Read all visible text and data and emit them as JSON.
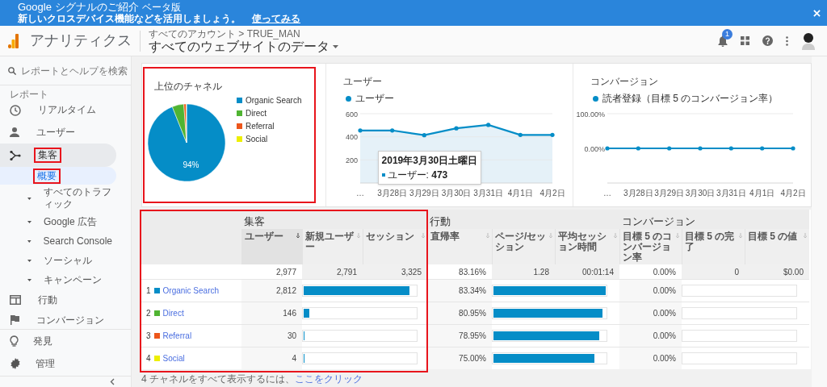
{
  "banner": {
    "title": "Google シグナルのご紹介",
    "badge": "ベータ版",
    "message": "新しいクロスデバイス機能などを活用しましょう。",
    "link": "使ってみる"
  },
  "header": {
    "product": "アナリティクス",
    "breadcrumb": "すべてのアカウント > TRUE_MAN",
    "view": "すべてのウェブサイトのデータ",
    "notification_count": "1"
  },
  "sidebar": {
    "search": {
      "placeholder": "レポートとヘルプを検索"
    },
    "section_label": "レポート",
    "items": [
      {
        "label": "リアルタイム",
        "highlighted": false
      },
      {
        "label": "ユーザー",
        "highlighted": false
      },
      {
        "label": "集客",
        "highlighted": true,
        "expanded": true,
        "children": [
          {
            "label": "概要",
            "selected": true,
            "highlighted": true
          },
          {
            "label": "すべてのトラフィック",
            "selected": false,
            "highlighted": false,
            "expanded": false
          },
          {
            "label": "Google 広告",
            "selected": false,
            "highlighted": false,
            "expanded": false
          },
          {
            "label": "Search Console",
            "selected": false,
            "highlighted": false,
            "expanded": false
          },
          {
            "label": "ソーシャル",
            "selected": false,
            "highlighted": false,
            "expanded": false
          },
          {
            "label": "キャンペーン",
            "selected": false,
            "highlighted": false,
            "expanded": false
          }
        ]
      },
      {
        "label": "行動",
        "highlighted": false,
        "expanded": false
      },
      {
        "label": "コンバージョン",
        "highlighted": false,
        "expanded": false
      }
    ],
    "bottom_items": [
      {
        "label": "発見"
      },
      {
        "label": "管理"
      }
    ]
  },
  "cards": [
    {
      "title": "上位のチャネル",
      "highlighted": true,
      "chart_data": {
        "type": "pie",
        "categories": [
          "Organic Search",
          "Direct",
          "Referral",
          "Social"
        ],
        "series": [
          {
            "values": [
              93.99,
              4.88,
              1.0,
              0.13
            ]
          }
        ],
        "colors": [
          "#058dc7",
          "#50b432",
          "#ed561b",
          "#edef00"
        ],
        "value_labels": [
          "94%",
          null,
          null,
          null
        ]
      }
    },
    {
      "title": "ユーザー",
      "highlighted": false,
      "chart_data": {
        "type": "area",
        "categories": [
          "…",
          "3月28日",
          "3月29日",
          "3月30日",
          "3月31日",
          "4月1日",
          "4月2日"
        ],
        "series": [
          {
            "name": "ユーザー",
            "color": "#058dc7",
            "values": [
              455,
              455,
              414,
              473,
              503,
              416,
              416
            ]
          }
        ],
        "ylim": [
          0,
          600
        ],
        "yticks": [
          200,
          400,
          600
        ]
      },
      "tooltip": {
        "title": "2019年3月30日土曜日",
        "text": "ユーザー: **473**"
      }
    },
    {
      "title": "コンバージョン",
      "highlighted": false,
      "chart_data": {
        "type": "line",
        "categories": [
          "…",
          "3月28日",
          "3月29日",
          "3月30日",
          "3月31日",
          "4月1日",
          "4月2日"
        ],
        "series": [
          {
            "name": "読者登録（目標 5 のコンバージョン率）",
            "color": "#058dc7",
            "values": [
              0,
              0,
              0,
              0,
              0,
              0,
              0
            ]
          }
        ],
        "ylim": [
          -100,
          100
        ],
        "yticks": [
          {
            "value": 0,
            "label": "0.00%"
          },
          {
            "value": 100,
            "label": "100.00%"
          }
        ]
      }
    }
  ],
  "table": {
    "highlighted": true,
    "groups": [
      "集客",
      "行動",
      "コンバージョン"
    ],
    "columns": [
      {
        "label": "ユーザー",
        "sorted": true
      },
      {
        "label": "新規ユーザー",
        "sorted": false
      },
      {
        "label": "セッション",
        "sorted": false
      },
      {
        "label": "直帰率",
        "sorted": false
      },
      {
        "label": "ページ/セッション",
        "sorted": false
      },
      {
        "label": "平均セッション時間",
        "sorted": false
      },
      {
        "label": "目標 5 のコンバージョン率",
        "sorted": false
      },
      {
        "label": "目標 5 の完了",
        "sorted": false
      },
      {
        "label": "目標 5 の値",
        "sorted": false
      }
    ],
    "totals": [
      "2,977",
      "2,791",
      "3,325",
      "83.16%",
      "1.28",
      "00:01:14",
      "0.00%",
      "0",
      "$0.00"
    ],
    "rows": [
      {
        "rank": "1",
        "channel": "Organic Search",
        "color": "#058dc7",
        "users": "2,812",
        "acquisition_bar": {
          "level": 0.945
        },
        "bounce_rate": "83.34%",
        "behavior_bar": {
          "level": 1.0
        },
        "conversion_rate": "0.00%",
        "conversion_bar": {
          "level": 0
        }
      },
      {
        "rank": "2",
        "channel": "Direct",
        "color": "#50b432",
        "users": "146",
        "acquisition_bar": {
          "level": 0.049
        },
        "bounce_rate": "80.95%",
        "behavior_bar": {
          "level": 0.97
        },
        "conversion_rate": "0.00%",
        "conversion_bar": {
          "level": 0
        }
      },
      {
        "rank": "3",
        "channel": "Referral",
        "color": "#ed561b",
        "users": "30",
        "acquisition_bar": {
          "level": 0.01
        },
        "bounce_rate": "78.95%",
        "behavior_bar": {
          "level": 0.945
        },
        "conversion_rate": "0.00%",
        "conversion_bar": {
          "level": 0
        }
      },
      {
        "rank": "4",
        "channel": "Social",
        "color": "#edef00",
        "users": "4",
        "acquisition_bar": {
          "level": 0.004
        },
        "bounce_rate": "75.00%",
        "behavior_bar": {
          "level": 0.9
        },
        "conversion_rate": "0.00%",
        "conversion_bar": {
          "level": 0
        }
      }
    ],
    "footnote": {
      "text": "4 チャネルをすべて表示するには、",
      "link": "ここをクリック"
    }
  }
}
